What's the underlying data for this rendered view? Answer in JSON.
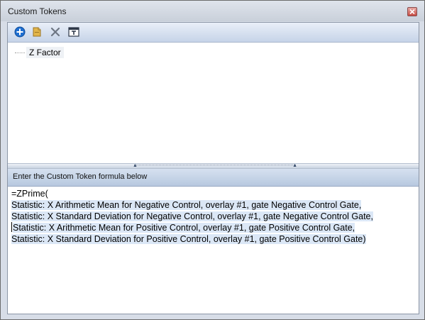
{
  "window": {
    "title": "Custom Tokens"
  },
  "toolbar": {
    "buttons": [
      {
        "name": "add",
        "icon": "plus-circle-icon"
      },
      {
        "name": "new-folder",
        "icon": "folder-icon"
      },
      {
        "name": "delete",
        "icon": "x-delete-icon"
      },
      {
        "name": "rename",
        "icon": "rename-text-icon"
      }
    ]
  },
  "tree": {
    "items": [
      {
        "label": "Z Factor"
      }
    ]
  },
  "section": {
    "header": "Enter the Custom Token formula below"
  },
  "formula": {
    "lines": [
      "=ZPrime(",
      "Statistic: X Arithmetic Mean for Negative Control, overlay #1, gate Negative Control Gate,",
      "Statistic: X Standard Deviation for Negative Control, overlay #1, gate Negative Control Gate,",
      "Statistic: X Arithmetic Mean for Positive Control, overlay #1, gate Positive Control Gate,",
      "Statistic: X Standard Deviation for Positive Control, overlay #1, gate Positive Control Gate)"
    ]
  },
  "colors": {
    "accent": "#1f6fd1",
    "selection": "#dbe7f6",
    "close": "#c74c43"
  }
}
